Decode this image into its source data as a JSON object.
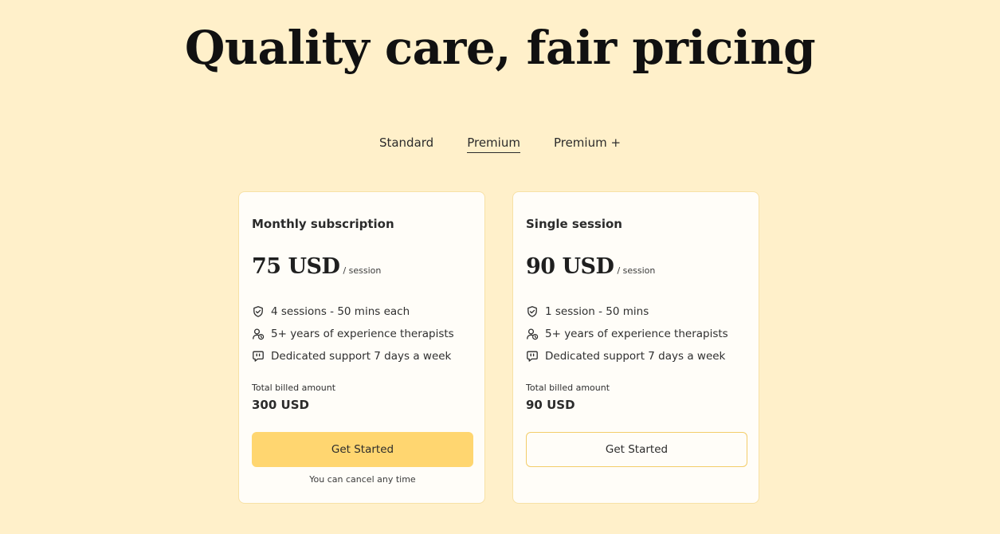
{
  "headline": "Quality care, fair pricing",
  "tabs": [
    {
      "label": "Standard",
      "active": false
    },
    {
      "label": "Premium",
      "active": true
    },
    {
      "label": "Premium +",
      "active": false
    }
  ],
  "plans": [
    {
      "title": "Monthly subscription",
      "price": "75 USD",
      "unit": "/ session",
      "features": [
        {
          "icon": "shield-check-icon",
          "text": "4 sessions - 50 mins each"
        },
        {
          "icon": "user-clock-icon",
          "text": "5+ years of experience therapists"
        },
        {
          "icon": "chat-bubble-icon",
          "text": "Dedicated support 7 days a week"
        }
      ],
      "billed_label": "Total billed amount",
      "billed_amount": "300 USD",
      "button_label": "Get Started",
      "note": "You can cancel any time"
    },
    {
      "title": "Single session",
      "price": "90 USD",
      "unit": "/ session",
      "features": [
        {
          "icon": "shield-check-icon",
          "text": "1 session - 50 mins"
        },
        {
          "icon": "user-clock-icon",
          "text": "5+ years of experience therapists"
        },
        {
          "icon": "chat-bubble-icon",
          "text": "Dedicated support 7 days a week"
        }
      ],
      "billed_label": "Total billed amount",
      "billed_amount": "90 USD",
      "button_label": "Get Started"
    }
  ],
  "colors": {
    "background": "#fff0ca",
    "card": "#fffdf8",
    "accent": "#ffd670",
    "card_border": "#f7e1a6"
  }
}
